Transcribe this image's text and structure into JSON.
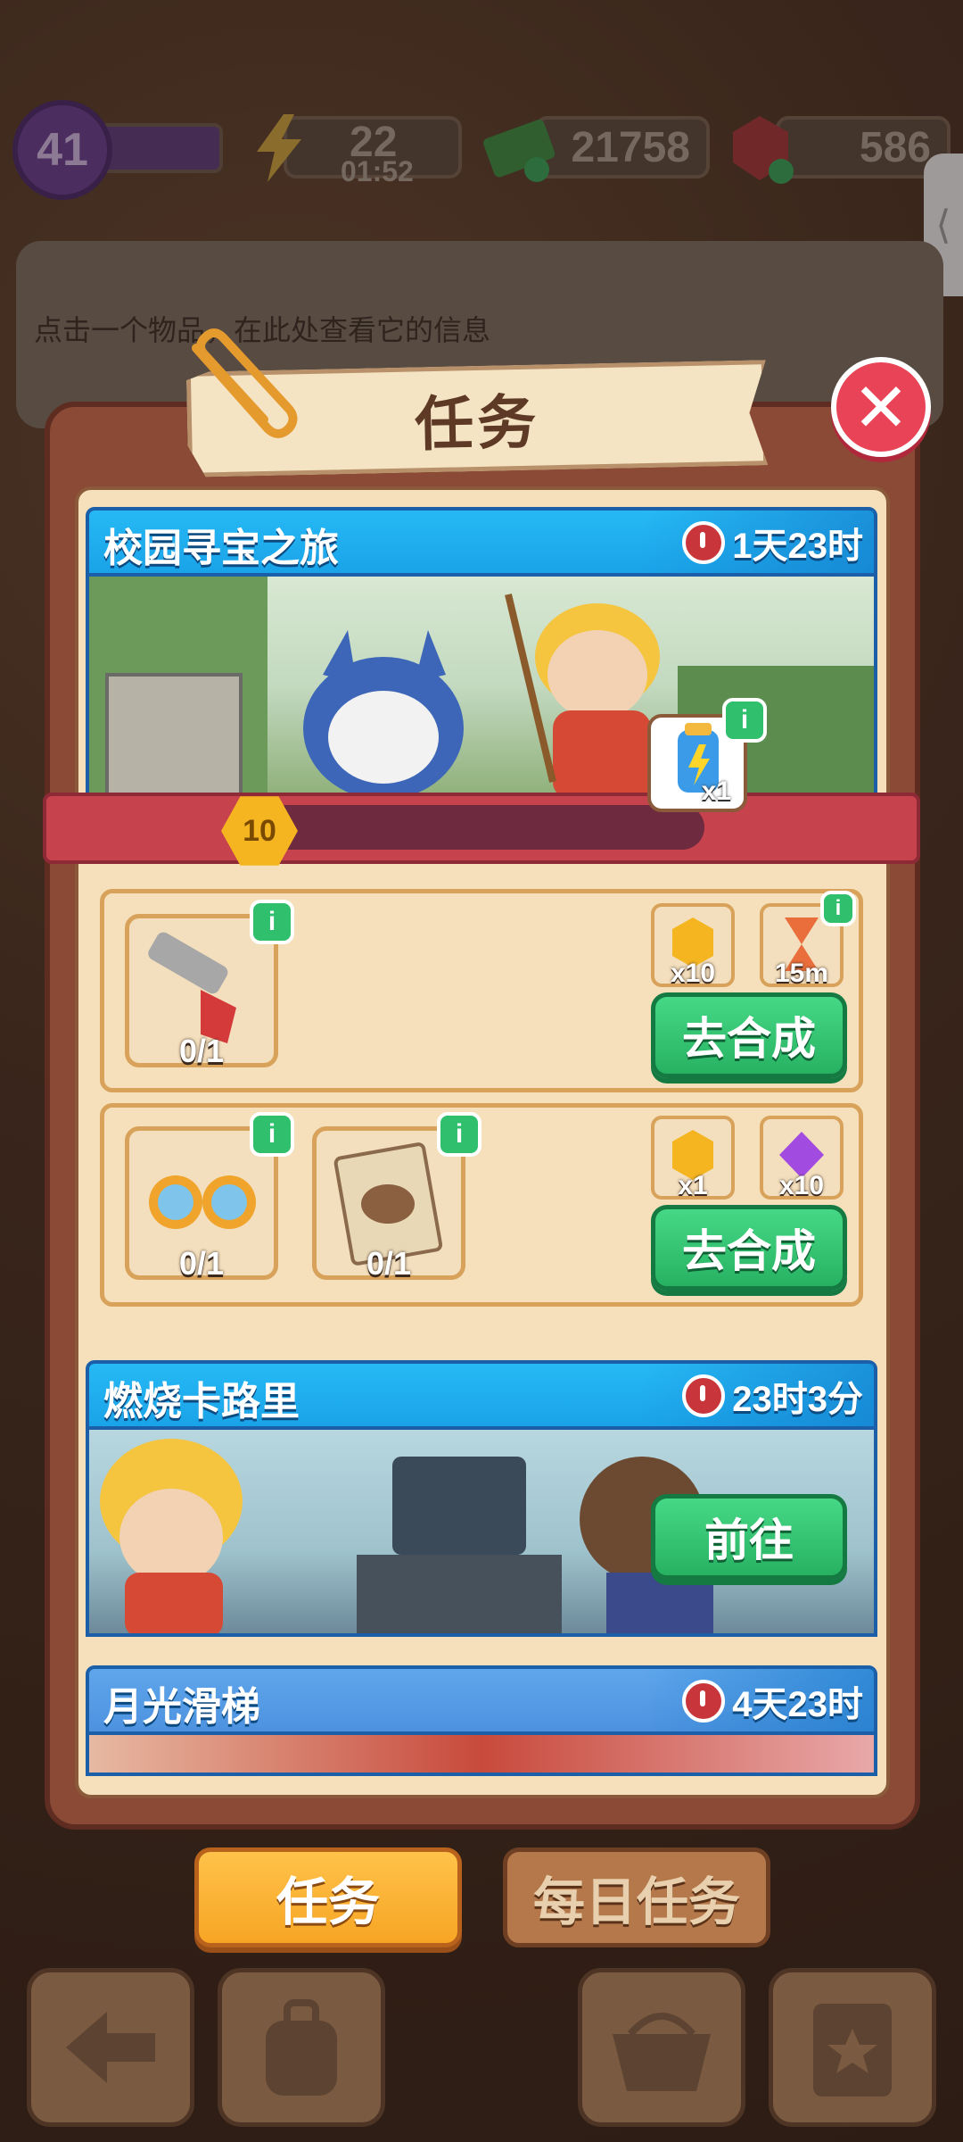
{
  "top_bar": {
    "level": "41",
    "energy": "22",
    "energy_timer": "01:52",
    "cash": "21758",
    "gems": "586"
  },
  "info_panel": {
    "hint": "点击一个物品，在此处查看它的信息"
  },
  "modal": {
    "title": "任务",
    "close_label": "✕"
  },
  "tasks": [
    {
      "title": "校园寻宝之旅",
      "timer": "1天23时",
      "progress_level": "10",
      "progress_fraction": 0.12,
      "chest_reward": "x1",
      "subtasks": [
        {
          "items": [
            {
              "name": "wrench",
              "count": "0/1"
            }
          ],
          "rewards": [
            {
              "icon": "coin-icon",
              "count": "x10"
            },
            {
              "icon": "hourglass-icon",
              "count": "15m"
            }
          ],
          "button": "去合成"
        },
        {
          "items": [
            {
              "name": "sunglasses",
              "count": "0/1"
            },
            {
              "name": "coupon",
              "count": "0/1"
            }
          ],
          "rewards": [
            {
              "icon": "coin-icon",
              "count": "x1"
            },
            {
              "icon": "purple-gem-icon",
              "count": "x10"
            }
          ],
          "button": "去合成"
        }
      ]
    },
    {
      "title": "燃烧卡路里",
      "timer": "23时3分",
      "button": "前往"
    },
    {
      "title": "月光滑梯",
      "timer": "4天23时"
    }
  ],
  "tabs": {
    "active": "任务",
    "inactive": "每日任务"
  },
  "colors": {
    "header_blue": "#1aa3e8",
    "green_button": "#27b262",
    "close_red": "#e84357",
    "tab_orange": "#f7a524"
  }
}
